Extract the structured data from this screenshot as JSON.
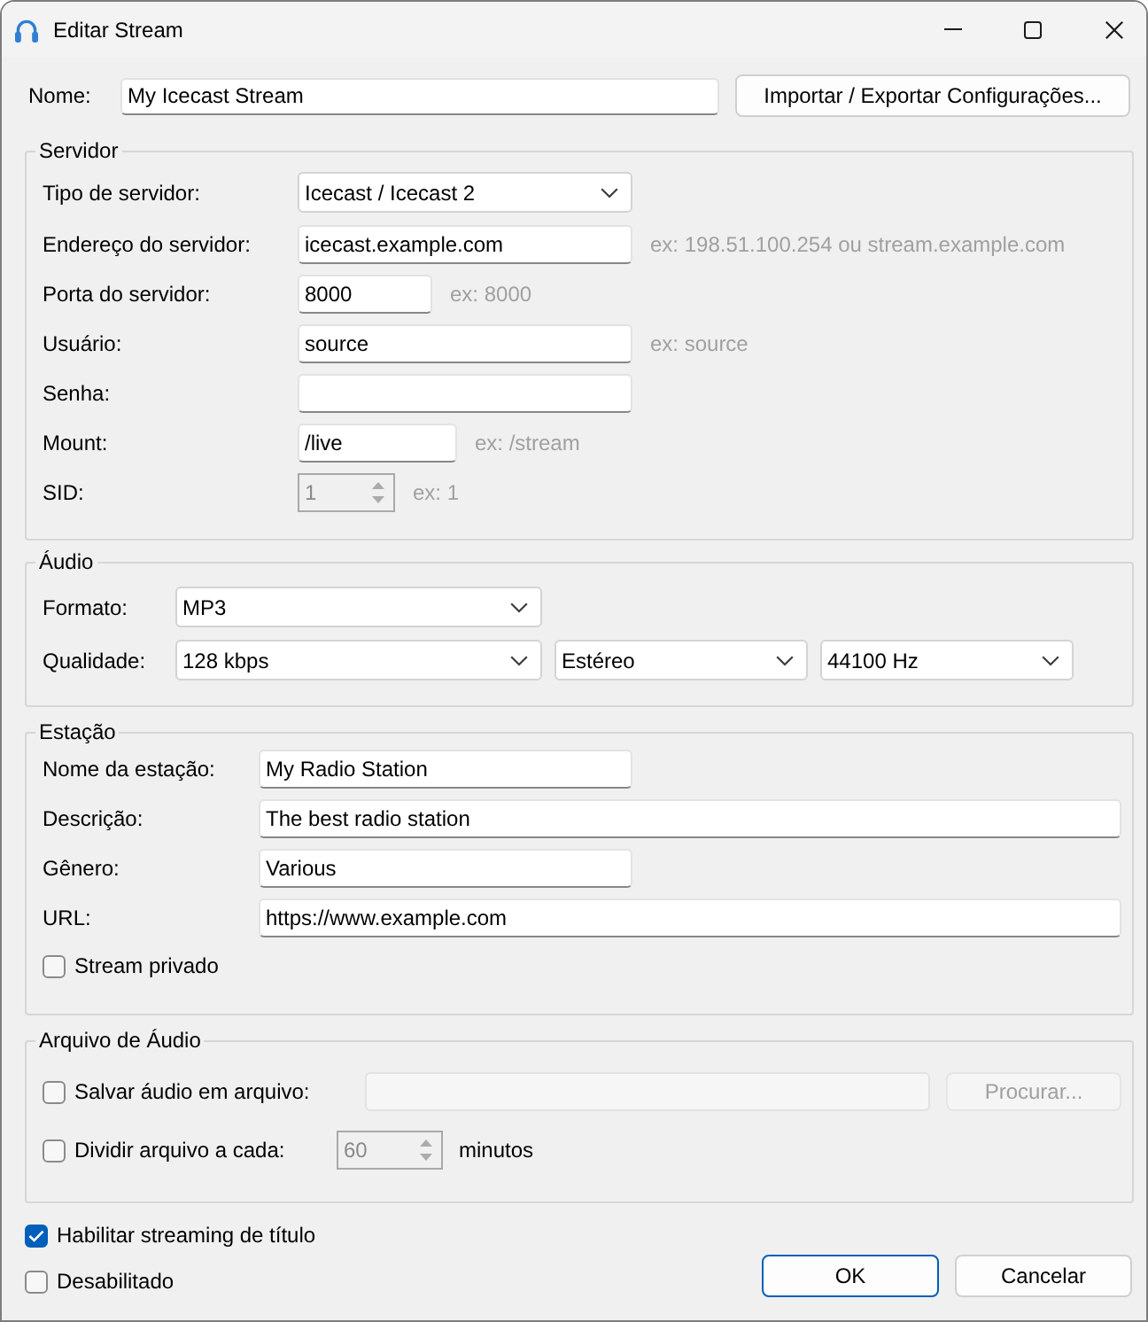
{
  "window": {
    "title": "Editar Stream"
  },
  "name": {
    "label": "Nome:",
    "value": "My Icecast Stream"
  },
  "import_export_button": {
    "label": "Importar / Exportar Configurações..."
  },
  "server": {
    "title": "Servidor",
    "server_type": {
      "label": "Tipo de servidor:",
      "value": "Icecast / Icecast 2"
    },
    "address": {
      "label": "Endereço do servidor:",
      "value": "icecast.example.com",
      "hint": "ex: 198.51.100.254 ou stream.example.com"
    },
    "port": {
      "label": "Porta do servidor:",
      "value": "8000",
      "hint": "ex: 8000"
    },
    "user": {
      "label": "Usuário:",
      "value": "source",
      "hint": "ex: source"
    },
    "password": {
      "label": "Senha:"
    },
    "mount": {
      "label": "Mount:",
      "value": "/live",
      "hint": "ex: /stream"
    },
    "sid": {
      "label": "SID:",
      "value": "1",
      "hint": "ex: 1",
      "disabled": true
    }
  },
  "audio": {
    "title": "Áudio",
    "format": {
      "label": "Formato:",
      "value": "MP3"
    },
    "quality": {
      "label": "Qualidade:",
      "bitrate": "128 kbps",
      "channels": "Estéreo",
      "sample_rate": "44100 Hz"
    }
  },
  "station": {
    "title": "Estação",
    "name": {
      "label": "Nome da estação:",
      "value": "My Radio Station"
    },
    "description": {
      "label": "Descrição:",
      "value": "The best radio station"
    },
    "genre": {
      "label": "Gênero:",
      "value": "Various"
    },
    "url": {
      "label": "URL:",
      "value": "https://www.example.com"
    },
    "private": {
      "label": "Stream privado",
      "checked": false
    }
  },
  "audio_file": {
    "title": "Arquivo de Áudio",
    "save": {
      "label": "Salvar áudio em arquivo:",
      "checked": false,
      "path_field": {
        "disabled": true
      },
      "browse_button": {
        "label": "Procurar...",
        "disabled": true
      }
    },
    "split": {
      "label": "Dividir arquivo a cada:",
      "checked": false,
      "interval": {
        "value": "60",
        "disabled": true
      },
      "unit": "minutos"
    }
  },
  "title_streaming": {
    "label": "Habilitar streaming de título",
    "checked": true
  },
  "disabled_option": {
    "label": "Desabilitado",
    "checked": false
  },
  "buttons": [
    {
      "label": "OK",
      "default": true
    },
    {
      "label": "Cancelar",
      "default": false
    }
  ]
}
